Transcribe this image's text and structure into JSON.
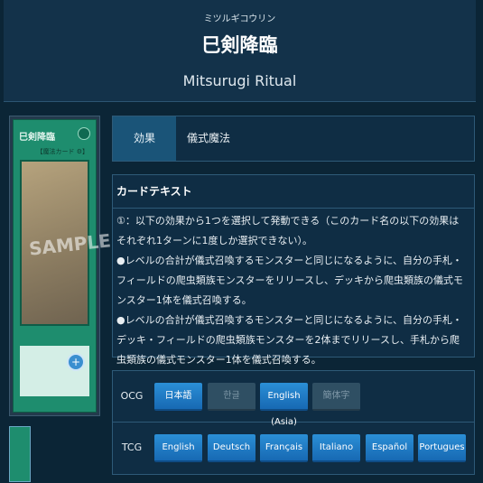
{
  "header": {
    "ruby": "ミツルギコウリン",
    "name_jp": "巳剣降臨",
    "name_en": "Mitsurugi Ritual"
  },
  "card_image": {
    "title": "巳剣降臨",
    "attribute_glyph": "魔",
    "type_line": "【魔法カード ⚙】",
    "watermark": "SAMPLE",
    "zoom_glyph": "+"
  },
  "info": {
    "label": "効果",
    "value": "儀式魔法"
  },
  "card_text": {
    "heading": "カードテキスト",
    "paragraphs": [
      "①：以下の効果から1つを選択して発動できる（このカード名の以下の効果はそれぞれ1ターンに1度しか選択できない）。",
      "●レベルの合計が儀式召喚するモンスターと同じになるように、自分の手札・フィールドの爬虫類族モンスターをリリースし、デッキから爬虫類族の儀式モンスター1体を儀式召喚する。",
      "●レベルの合計が儀式召喚するモンスターと同じになるように、自分の手札・デッキ・フィールドの爬虫類族モンスターを2体までリリースし、手札から爬虫類族の儀式モンスター1体を儀式召喚する。"
    ]
  },
  "languages": {
    "ocg": {
      "label": "OCG",
      "buttons": [
        {
          "label": "日本語",
          "enabled": true
        },
        {
          "label": "한글",
          "enabled": false
        },
        {
          "label": "English (Asia)",
          "enabled": true
        },
        {
          "label": "簡体字",
          "enabled": false
        }
      ]
    },
    "tcg": {
      "label": "TCG",
      "buttons": [
        {
          "label": "English",
          "enabled": true
        },
        {
          "label": "Deutsch",
          "enabled": true
        },
        {
          "label": "Français",
          "enabled": true
        },
        {
          "label": "Italiano",
          "enabled": true
        },
        {
          "label": "Español",
          "enabled": true
        },
        {
          "label": "Portugues",
          "enabled": true
        }
      ]
    }
  },
  "colors": {
    "background": "#0b2536",
    "panel": "#0f2d44",
    "accent_blue": "#1f7fc8",
    "spell_green": "#1e8d6e"
  }
}
